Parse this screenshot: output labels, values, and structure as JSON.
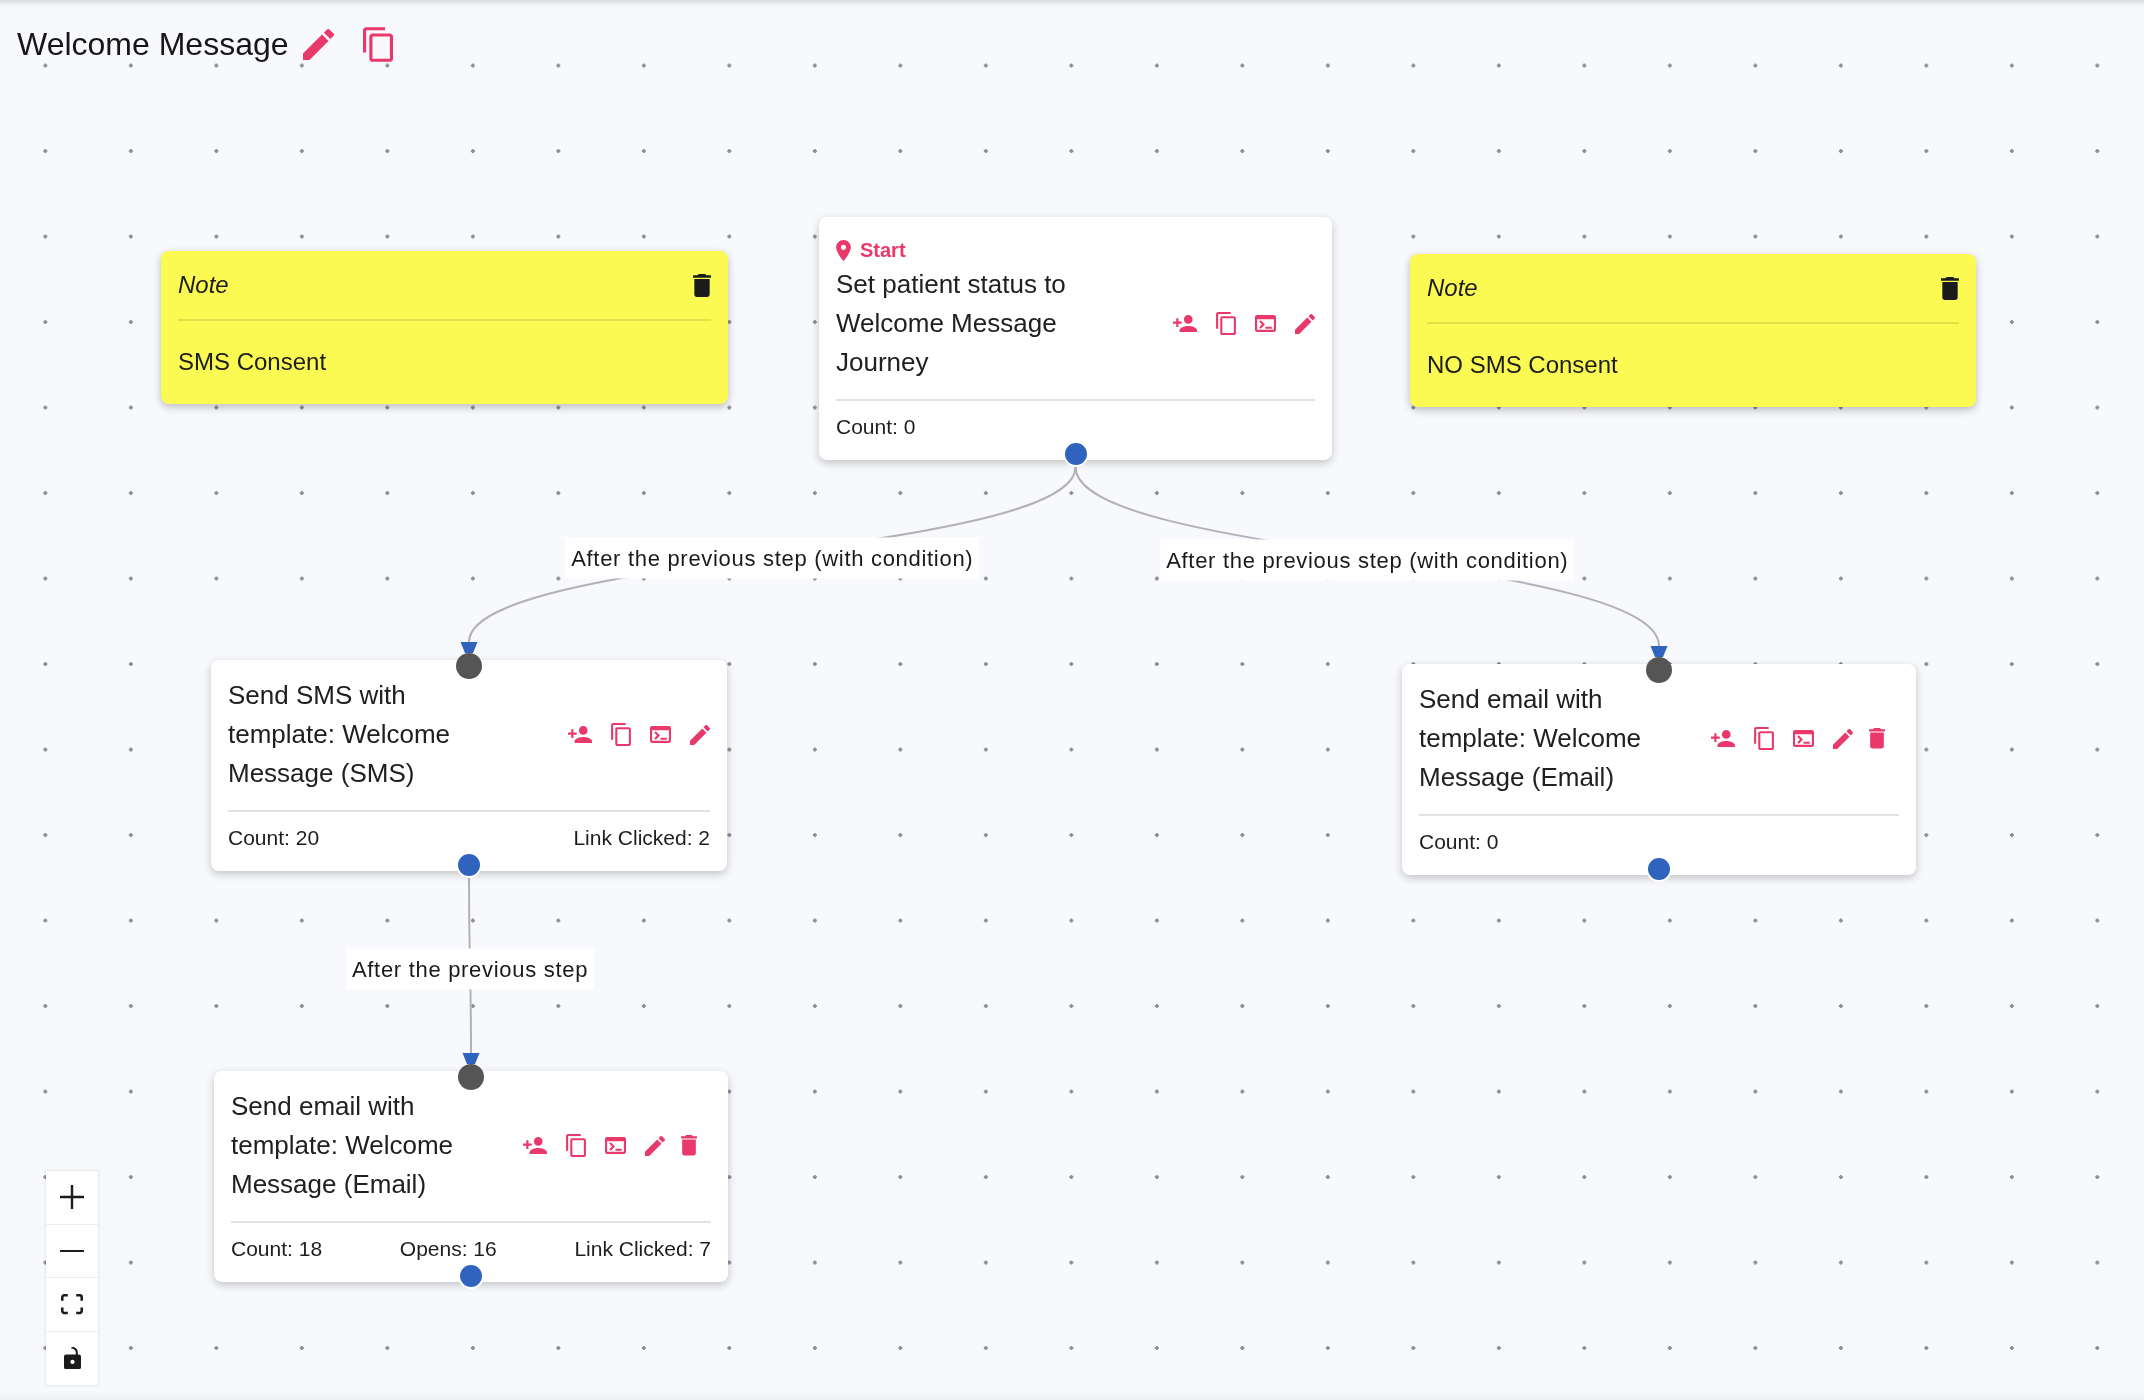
{
  "title": "Welcome Message",
  "notes": [
    {
      "heading": "Note",
      "text": "SMS Consent"
    },
    {
      "heading": "Note",
      "text": "NO SMS Consent"
    }
  ],
  "flow": {
    "badge": "Start",
    "text": "Set patient status to Welcome Message Journey",
    "deletable": false,
    "stats": [
      "Count: 0"
    ],
    "next": [
      {
        "label": "After the previous step (with condition)",
        "node": {
          "text": "Send SMS with template: Welcome Message (SMS)",
          "deletable": false,
          "stats": [
            "Count: 20",
            "Link Clicked: 2"
          ],
          "next": [
            {
              "label": "After the previous step",
              "node": {
                "text": "Send email with template: Welcome Message (Email)",
                "deletable": true,
                "stats": [
                  "Count: 18",
                  "Opens: 16",
                  "Link Clicked: 7"
                ]
              }
            }
          ]
        }
      },
      {
        "label": "After the previous step (with condition)",
        "node": {
          "text": "Send email with template: Welcome Message (Email)",
          "deletable": true,
          "stats": [
            "Count: 0"
          ]
        }
      }
    ]
  },
  "canvas_controls": {
    "locked": false
  }
}
